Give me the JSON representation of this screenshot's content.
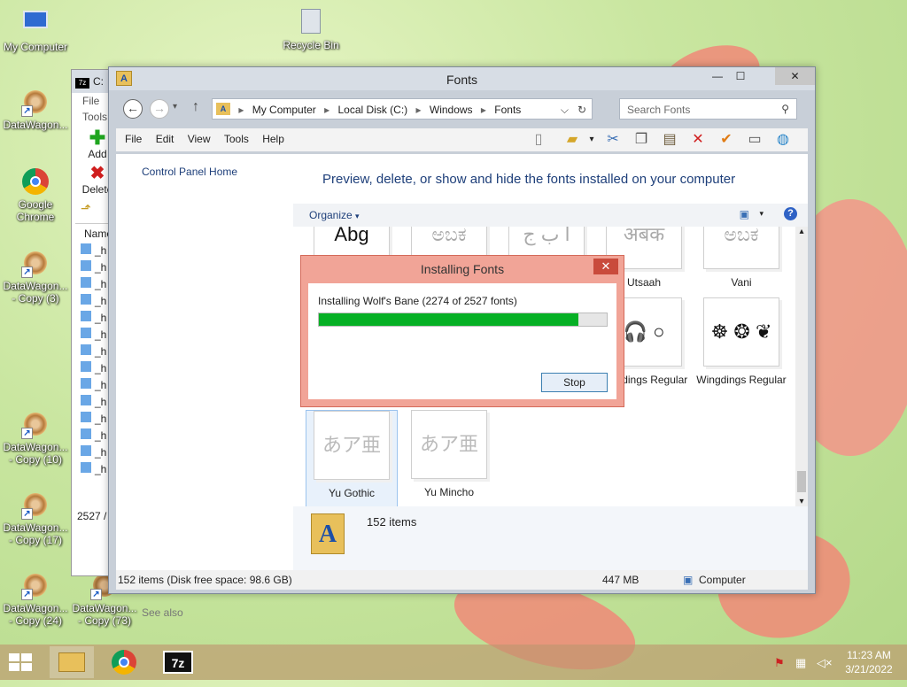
{
  "desktop": {
    "icons": [
      {
        "label": "My Computer"
      },
      {
        "label": "Recycle Bin"
      },
      {
        "label": "DataWagon..."
      },
      {
        "label": "Google Chrome"
      },
      {
        "label": "DataWagon... - Copy (3)"
      },
      {
        "label": "DataWagon... - Copy (10)"
      },
      {
        "label": "DataWagon... - Copy (17)"
      },
      {
        "label": "DataWagon... - Copy (24)"
      },
      {
        "label": "DataWagon... - Copy (73)"
      }
    ]
  },
  "bg_window": {
    "title": "C:",
    "menu": [
      "File",
      "Tools"
    ],
    "toolbar": [
      "Add",
      "Delete"
    ],
    "column": "Name",
    "status": "2527 /",
    "rows": [
      "_h",
      "_h",
      "_h",
      "_h",
      "_h",
      "_h",
      "_h",
      "_h",
      "_h",
      "_h",
      "_h",
      "_h",
      "_h",
      "_h"
    ]
  },
  "window": {
    "title": "Fonts",
    "breadcrumb": [
      "My Computer",
      "Local Disk (C:)",
      "Windows",
      "Fonts"
    ],
    "search_placeholder": "Search Fonts",
    "menu": [
      "File",
      "Edit",
      "View",
      "Tools",
      "Help"
    ],
    "left_pane": {
      "link": "Control Panel Home",
      "see_also": "See also"
    },
    "heading": "Preview, delete, or show and hide the fonts installed on your computer",
    "organize": "Organize",
    "tiles": [
      {
        "preview": "Abg",
        "label": ""
      },
      {
        "preview": "ಅಬಕ",
        "label": ""
      },
      {
        "preview": "أ ب ج",
        "label": ""
      },
      {
        "preview": "अबक",
        "label": "Utsaah"
      },
      {
        "preview": "ಅಬಕ",
        "label": "Vani"
      },
      {
        "preview": "🎧 ○",
        "label": "Webdings Regular"
      },
      {
        "preview": "☸ ❂ ❦",
        "label": "Wingdings Regular"
      },
      {
        "preview": "あア亜",
        "label": "Yu Gothic"
      },
      {
        "preview": "あア亜",
        "label": "Yu Mincho"
      }
    ],
    "details_count": "152 items",
    "status": {
      "left": "152 items (Disk free space: 98.6 GB)",
      "size": "447 MB",
      "location": "Computer"
    }
  },
  "dialog": {
    "title": "Installing Fonts",
    "message": "Installing Wolf's Bane (2274 of 2527 fonts)",
    "progress": 0.9,
    "stop": "Stop"
  },
  "taskbar": {
    "time": "11:23 AM",
    "date": "3/21/2022"
  },
  "colors": {
    "progress": "#06b025",
    "heading": "#1e3f7a",
    "dialog_frame": "#f1a497"
  }
}
